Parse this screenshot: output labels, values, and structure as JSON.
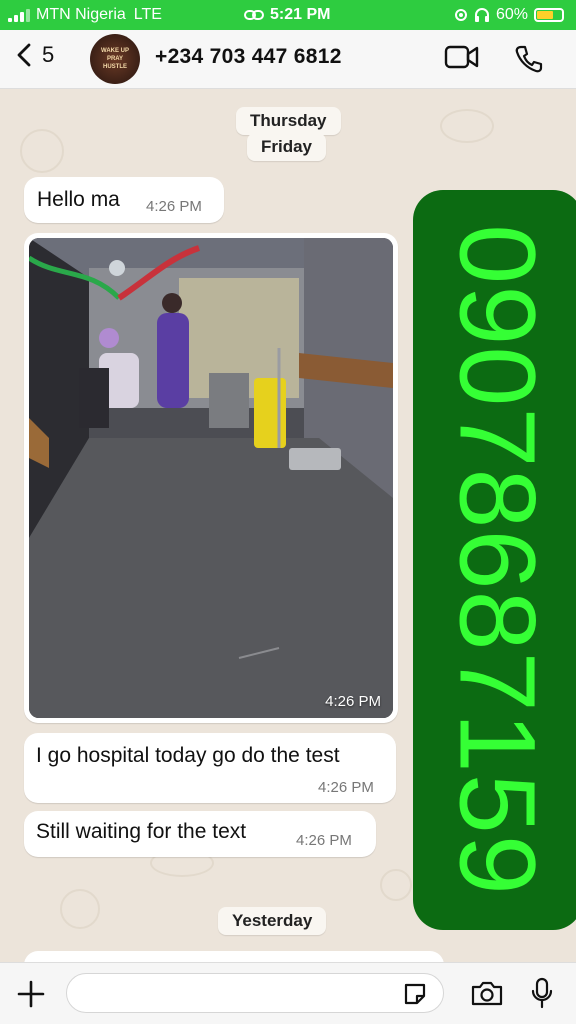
{
  "status_bar": {
    "carrier": "MTN Nigeria",
    "network": "LTE",
    "time": "5:21 PM",
    "battery": "60%",
    "battery_level": 0.6,
    "colors": {
      "background": "#2ecc40"
    }
  },
  "header": {
    "unread_count": "5",
    "contact_name": "+234 703 447 6812",
    "avatar_text": [
      "WAKE UP",
      "PRAY",
      "HUSTLE"
    ]
  },
  "chat": {
    "date_chips": [
      "Thursday",
      "Friday",
      "Yesterday"
    ],
    "messages": [
      {
        "text": "Hello ma",
        "time": "4:26 PM"
      },
      {
        "type": "photo",
        "time": "4:26 PM"
      },
      {
        "text": "I go hospital today go do the test",
        "time": "4:26 PM"
      },
      {
        "text": "Still waiting for the text",
        "time": "4:26 PM"
      }
    ]
  },
  "overlay": {
    "number": "09078687159",
    "colors": {
      "background": "#0c6b12",
      "text": "#35ff35"
    }
  },
  "input_bar": {
    "placeholder": "",
    "icons": [
      "plus-icon",
      "sticker-icon",
      "camera-icon",
      "microphone-icon"
    ]
  }
}
